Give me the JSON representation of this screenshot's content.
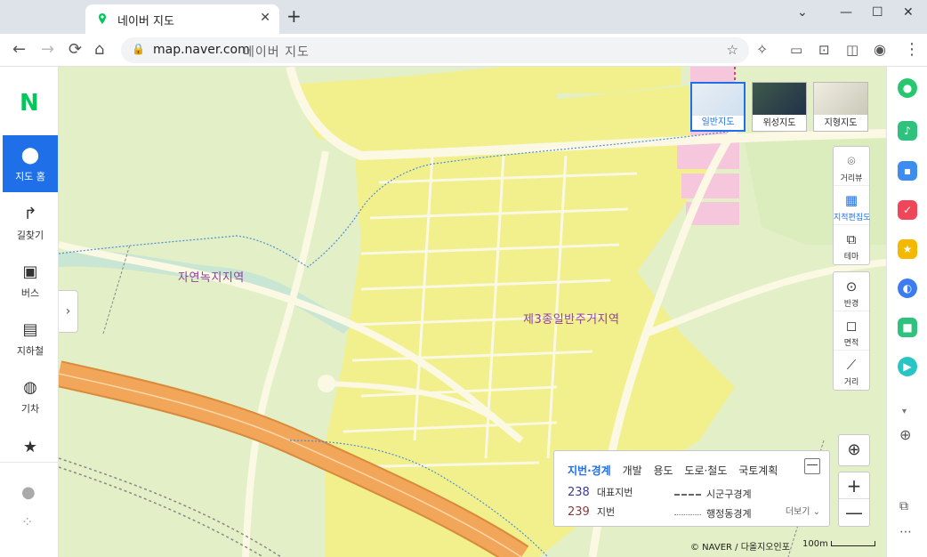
{
  "browser": {
    "tab_title": "네이버 지도",
    "new_tab": "+",
    "tab_close": "✕",
    "window": {
      "minimize": "—",
      "maximize": "☐",
      "close": "✕",
      "tab_list": "⌄"
    },
    "url": "map.naver.com",
    "page_title": "네이버 지도"
  },
  "nav": {
    "logo": "N",
    "items": [
      {
        "label": "지도 홈",
        "icon": "map-pin-icon"
      },
      {
        "label": "길찾기",
        "icon": "directions-icon"
      },
      {
        "label": "버스",
        "icon": "bus-icon"
      },
      {
        "label": "지하철",
        "icon": "subway-icon"
      },
      {
        "label": "기차",
        "icon": "train-icon"
      },
      {
        "label": "",
        "icon": "star-icon"
      }
    ]
  },
  "map": {
    "labels": [
      "자연녹지지역",
      "제3종일반주거지역"
    ],
    "map_types": [
      {
        "label": "일반지도",
        "active": true
      },
      {
        "label": "위성지도",
        "active": false
      },
      {
        "label": "지형지도",
        "active": false
      }
    ],
    "tools_group1": [
      {
        "label": "거리뷰",
        "icon": "streetview-icon"
      },
      {
        "label": "지적편집도",
        "icon": "cadastral-icon",
        "active": true
      },
      {
        "label": "테마",
        "icon": "theme-icon"
      }
    ],
    "tools_group2": [
      {
        "label": "반경",
        "icon": "radius-icon"
      },
      {
        "label": "면적",
        "icon": "area-icon"
      },
      {
        "label": "거리",
        "icon": "ruler-icon"
      }
    ],
    "zoom_in": "+",
    "zoom_out": "—"
  },
  "legend": {
    "tabs": [
      "지번·경계",
      "개발",
      "용도",
      "도로·철도",
      "국토계획"
    ],
    "active_tab": "지번·경계",
    "rows": [
      {
        "num": "238",
        "label": "대표지번",
        "num_color": "#3b3b8f"
      },
      {
        "num": "239",
        "label": "지번",
        "num_color": "#8a3b3b"
      }
    ],
    "lines": [
      {
        "label": "시군구경계",
        "color": "#666666",
        "style": "dashed"
      },
      {
        "label": "행정동경계",
        "color": "#4a8fd8",
        "style": "dotted"
      }
    ],
    "more": "더보기 ⌄",
    "minimize": "—"
  },
  "attribution": "© NAVER / 다올지오인포",
  "scale": "100m",
  "colors": {
    "accent": "#1e6fe8",
    "brand": "#03c75a",
    "residential": "#f2f08a",
    "green_zone": "#dfeec2",
    "commercial": "#f5c6dc",
    "highway": "#f2a65a"
  }
}
